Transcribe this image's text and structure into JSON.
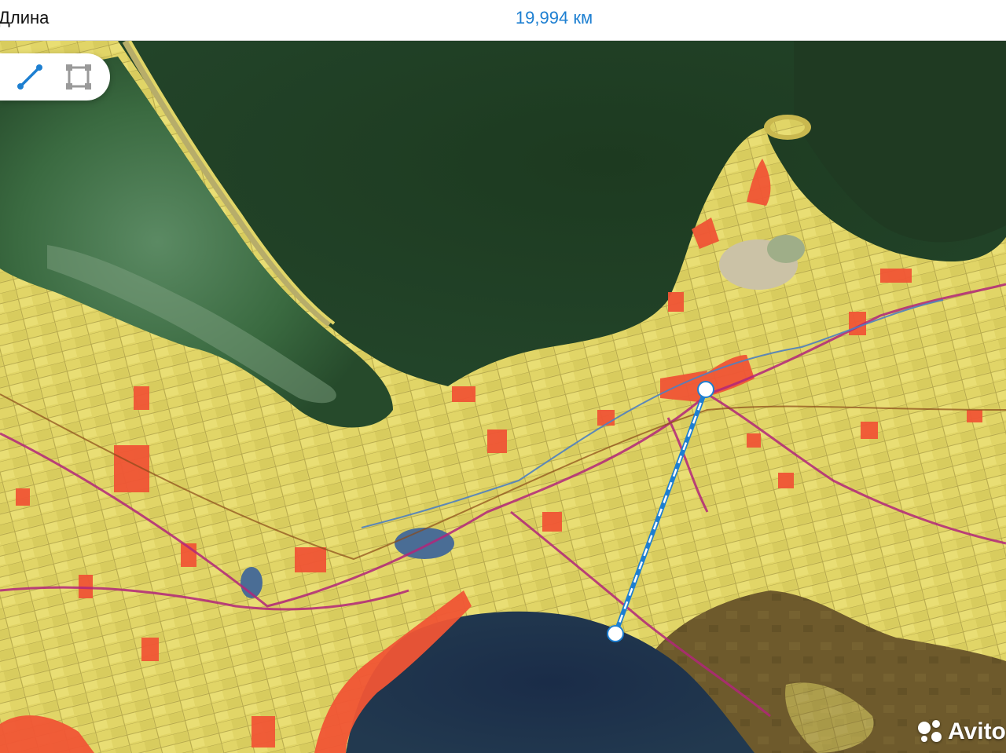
{
  "header": {
    "label": "Длина",
    "distance": "19,994 км"
  },
  "toolbar": {
    "tools": [
      {
        "name": "line-measure",
        "icon": "line-measure-icon",
        "active": true
      },
      {
        "name": "area-measure",
        "icon": "area-measure-icon",
        "active": false
      }
    ]
  },
  "map": {
    "colors": {
      "water_bay": "#1f3a22",
      "water_lagoon": "#2c5a34",
      "water_sea": "#182a45",
      "fields": "#e1d567",
      "urban": "#f05535",
      "roads": "#b2267a",
      "steppe": "#6e5a2c",
      "measure_line": "#1d7fd1"
    }
  },
  "watermark": {
    "text": "Avito"
  }
}
